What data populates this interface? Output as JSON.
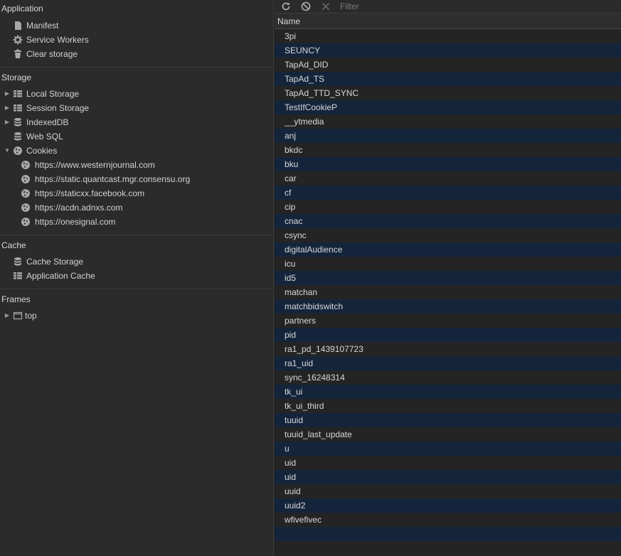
{
  "sidebar": {
    "application": {
      "title": "Application",
      "items": [
        {
          "label": "Manifest",
          "icon": "file-icon"
        },
        {
          "label": "Service Workers",
          "icon": "gear-icon"
        },
        {
          "label": "Clear storage",
          "icon": "trash-icon"
        }
      ]
    },
    "storage": {
      "title": "Storage",
      "items": [
        {
          "label": "Local Storage",
          "icon": "grid-icon",
          "expandable": true
        },
        {
          "label": "Session Storage",
          "icon": "grid-icon",
          "expandable": true
        },
        {
          "label": "IndexedDB",
          "icon": "database-icon",
          "expandable": true
        },
        {
          "label": "Web SQL",
          "icon": "database-icon"
        },
        {
          "label": "Cookies",
          "icon": "cookie-icon",
          "expanded": true
        }
      ],
      "cookie_origins": [
        "https://www.westernjournal.com",
        "https://static.quantcast.mgr.consensu.org",
        "https://staticxx.facebook.com",
        "https://acdn.adnxs.com",
        "https://onesignal.com"
      ]
    },
    "cache": {
      "title": "Cache",
      "items": [
        {
          "label": "Cache Storage",
          "icon": "database-icon"
        },
        {
          "label": "Application Cache",
          "icon": "grid-icon"
        }
      ]
    },
    "frames": {
      "title": "Frames",
      "items": [
        {
          "label": "top",
          "icon": "frame-icon",
          "expandable": true
        }
      ]
    }
  },
  "toolbar": {
    "refresh_icon": "refresh-icon",
    "clear_icon": "block-icon",
    "delete_icon": "close-icon",
    "filter_placeholder": "Filter"
  },
  "table": {
    "column": "Name",
    "rows": [
      "3pi",
      "SEUNCY",
      "TapAd_DID",
      "TapAd_TS",
      "TapAd_TTD_SYNC",
      "TestIfCookieP",
      "__ytmedia",
      "anj",
      "bkdc",
      "bku",
      "car",
      "cf",
      "cip",
      "cnac",
      "csync",
      "digitalAudience",
      "icu",
      "id5",
      "matchan",
      "matchbidswitch",
      "partners",
      "pid",
      "ra1_pd_1439107723",
      "ra1_uid",
      "sync_16248314",
      "tk_ui",
      "tk_ui_third",
      "tuuid",
      "tuuid_last_update",
      "u",
      "uid",
      "uid",
      "uuid",
      "uuid2",
      "wfivefivec"
    ]
  }
}
